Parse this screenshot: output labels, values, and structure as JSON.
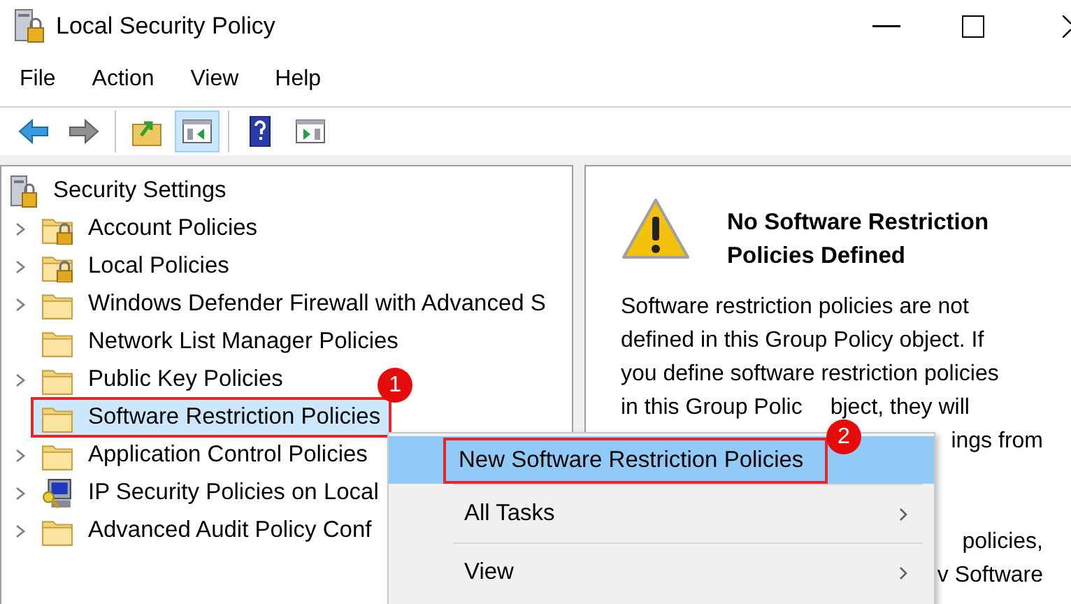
{
  "window": {
    "title": "Local Security Policy"
  },
  "menu_bar": [
    "File",
    "Action",
    "View",
    "Help"
  ],
  "toolbar": [
    [
      {
        "kind": "back",
        "selected": false
      },
      {
        "kind": "forward",
        "selected": false
      }
    ],
    [
      {
        "kind": "up",
        "selected": false
      },
      {
        "kind": "tree",
        "selected": true
      }
    ],
    [
      {
        "kind": "help",
        "selected": false
      },
      {
        "kind": "pane",
        "selected": false
      }
    ]
  ],
  "tree": {
    "label": "Security Settings",
    "children": [
      {
        "label": "Account Policies",
        "kind": "locked",
        "expandable": true,
        "selected": false
      },
      {
        "label": "Local Policies",
        "kind": "locked",
        "expandable": true,
        "selected": false
      },
      {
        "label": "Windows Defender Firewall with Advanced S",
        "kind": "folder",
        "expandable": true,
        "selected": false
      },
      {
        "label": "Network List Manager Policies",
        "kind": "folder",
        "expandable": false,
        "selected": false
      },
      {
        "label": "Public Key Policies",
        "kind": "folder",
        "expandable": true,
        "selected": false
      },
      {
        "label": "Software Restriction Policies",
        "kind": "folder",
        "expandable": false,
        "selected": true,
        "callout": "1"
      },
      {
        "label": "Application Control Policies",
        "kind": "folder",
        "expandable": true,
        "selected": false
      },
      {
        "label": "IP Security Policies on Local",
        "kind": "computer",
        "expandable": true,
        "selected": false
      },
      {
        "label": "Advanced Audit Policy Conf",
        "kind": "folder",
        "expandable": true,
        "selected": false
      }
    ]
  },
  "details": {
    "title": "No Software Restriction Policies Defined",
    "paragraphs": [
      [
        [
          {
            "text": "Software restriction policies are not",
            "kind": "start"
          }
        ],
        [
          {
            "text": "defined in this Group Policy object. If",
            "kind": "start"
          }
        ],
        [
          {
            "text": "you define software restriction policies",
            "kind": "start"
          }
        ],
        [
          {
            "text": "in this Group Polic",
            "kind": "start"
          },
          {
            "text": "bject, they will",
            "kind": "end"
          }
        ],
        [
          {
            "text": "ings from",
            "kind": "end"
          }
        ]
      ],
      [
        [
          {
            "text": "policies,",
            "kind": "end"
          }
        ],
        [
          {
            "text": "v Software",
            "kind": "end"
          }
        ]
      ]
    ]
  },
  "context_menu": [
    {
      "label": "New Software Restriction Policies",
      "selected": true,
      "submenu": false,
      "callout": "2"
    },
    {
      "label": "All Tasks",
      "selected": false,
      "submenu": true
    },
    {
      "label": "View",
      "selected": false,
      "submenu": true
    }
  ]
}
